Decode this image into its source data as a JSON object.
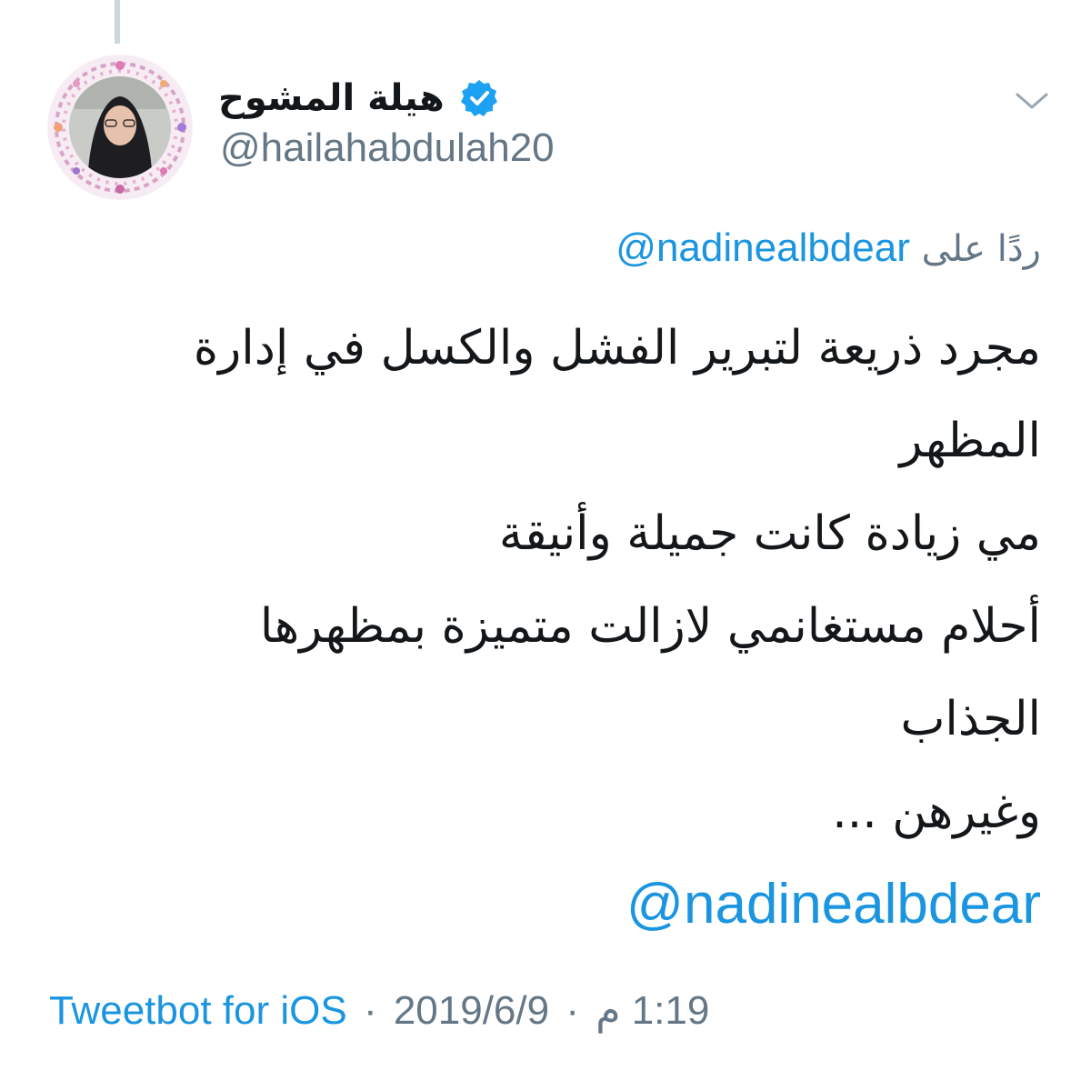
{
  "author": {
    "display_name": "هيلة المشوح",
    "handle": "@hailahabdulah20",
    "verified": true
  },
  "reply": {
    "prefix": "ردًا على",
    "mention": "@nadinealbdear"
  },
  "tweet": {
    "lines": [
      "مجرد ذريعة لتبرير الفشل والكسل في إدارة",
      "المظهر",
      "مي زيادة كانت جميلة وأنيقة",
      "أحلام مستغانمي لازالت متميزة بمظهرها",
      "الجذاب",
      "وغيرهن ..."
    ],
    "mention": "@nadinealbdear"
  },
  "meta": {
    "source": "Tweetbot for iOS",
    "separator": "·",
    "date": "2019/6/9",
    "time": "1:19 م"
  },
  "icons": {
    "verified": "verified-badge-icon",
    "chevron": "chevron-down-icon"
  },
  "colors": {
    "text": "#14171a",
    "secondary": "#657786",
    "link": "#1b95e0",
    "verified": "#1da1f2"
  }
}
